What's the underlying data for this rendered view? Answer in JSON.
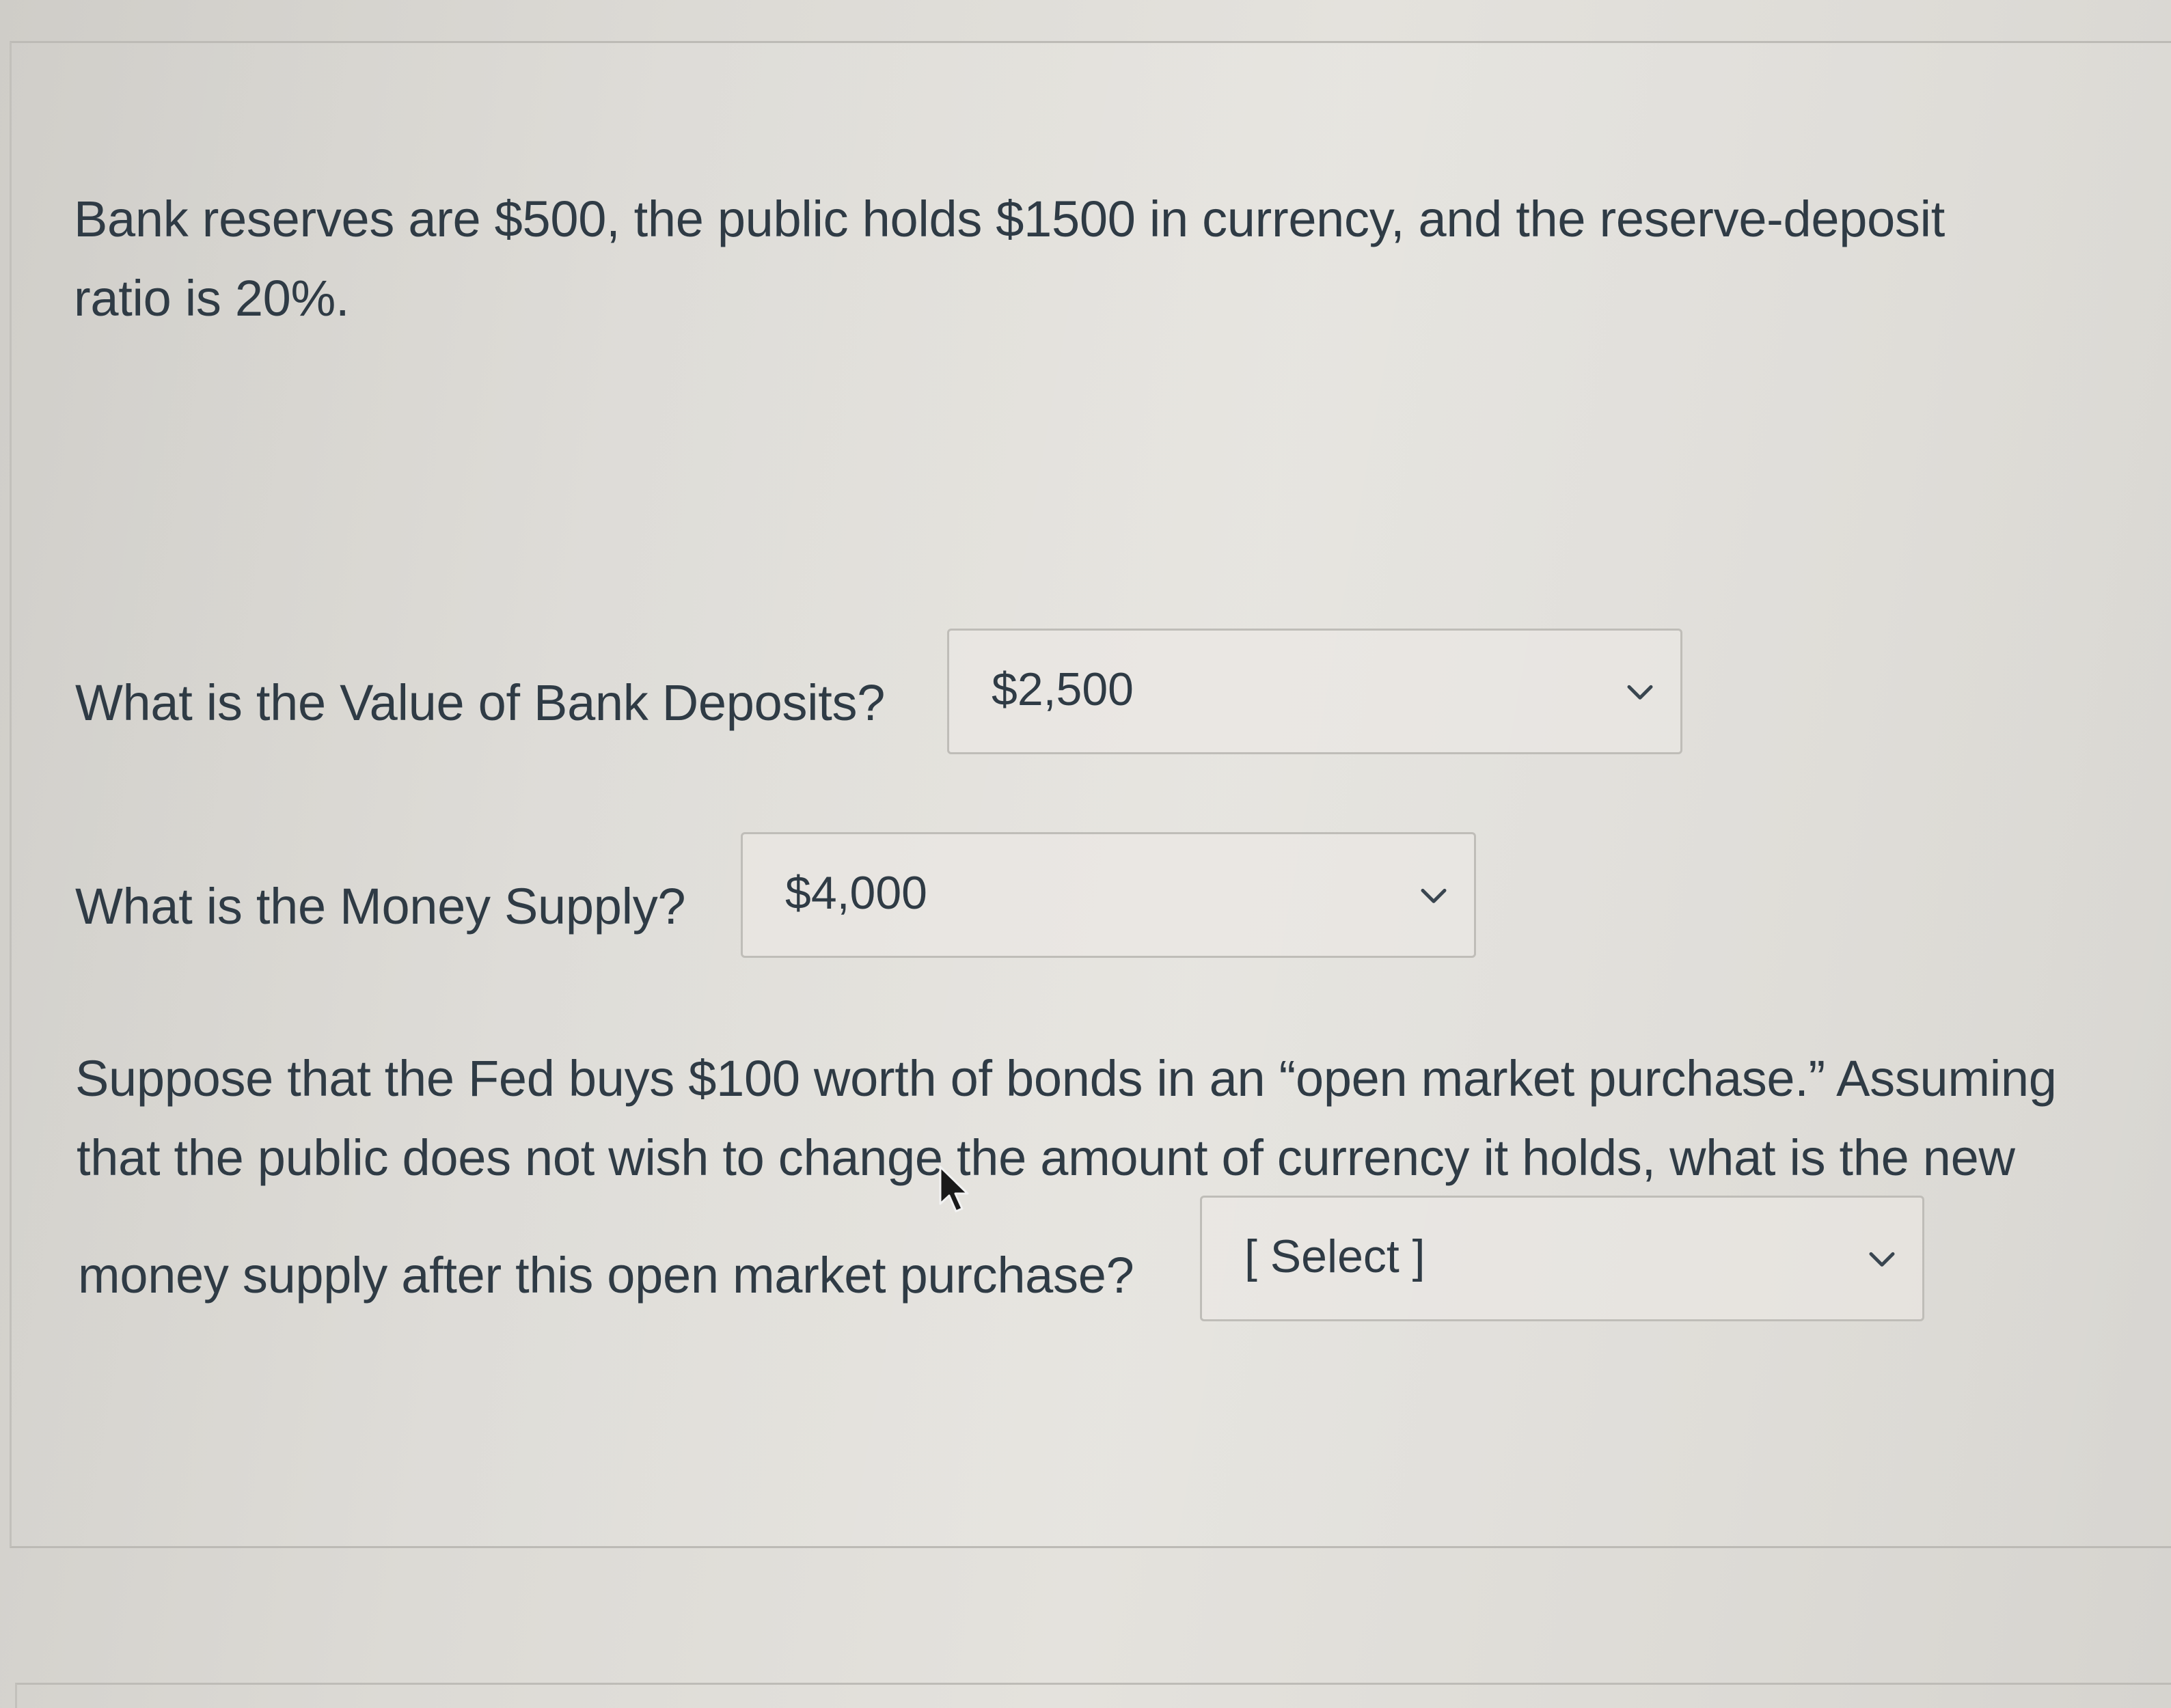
{
  "question": {
    "intro_line1": "Bank reserves are $500, the public holds $1500 in currency, and the reserve-deposit",
    "intro_line2": "ratio is 20%.",
    "q1": {
      "label": "What is the Value of Bank Deposits?",
      "selected": "$2,500"
    },
    "q2": {
      "label": "What is the Money Supply?",
      "selected": "$4,000"
    },
    "q3": {
      "line1": "Suppose that the Fed buys $100 worth of bonds in an “open market purchase.” Assuming",
      "line2": "that the public does not wish to change the amount of currency it holds, what is the new",
      "line3": "money supply after this open market purchase?",
      "selected": "[ Select ]"
    }
  },
  "icons": {
    "dropdown": "chevron-down-icon",
    "pointer": "mouse-cursor-icon"
  },
  "colors": {
    "text": "#2f3b45",
    "border": "#bfbdb8",
    "background": "#dcdad5"
  }
}
